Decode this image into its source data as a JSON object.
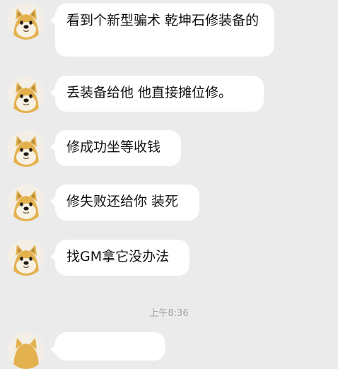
{
  "messages": [
    {
      "sender_avatar": "doge-avatar",
      "text": "看到个新型骗术 乾坤石修装备的"
    },
    {
      "sender_avatar": "doge-avatar",
      "text": "丢装备给他 他直接摊位修。"
    },
    {
      "sender_avatar": "doge-avatar",
      "text": "修成功坐等收钱"
    },
    {
      "sender_avatar": "doge-avatar",
      "text": "修失败还给你 装死"
    },
    {
      "sender_avatar": "doge-avatar",
      "text": "找GM拿它没办法"
    }
  ],
  "timestamp": "上午8:36",
  "colors": {
    "background": "#ebebeb",
    "bubble": "#ffffff",
    "text": "#111111",
    "timestamp": "#a3a3a3"
  }
}
